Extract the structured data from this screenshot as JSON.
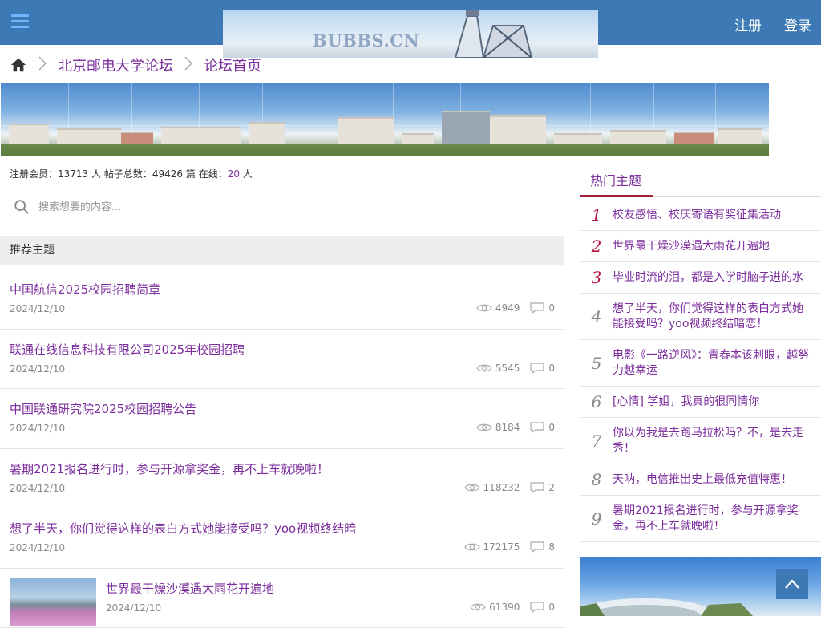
{
  "header": {
    "logo_text": "BUBBS.CN",
    "register_label": "注册",
    "login_label": "登录"
  },
  "breadcrumb": {
    "forum_name": "北京邮电大学论坛",
    "page_name": "论坛首页"
  },
  "stats": {
    "members_label": "注册会员：",
    "members_count": "13713",
    "members_unit": " 人 ",
    "posts_label": "帖子总数：",
    "posts_count": "49426",
    "posts_unit": " 篇 ",
    "online_label": "在线：",
    "online_count": "20",
    "online_unit": " 人"
  },
  "search": {
    "placeholder": "搜索想要的内容..."
  },
  "recommended": {
    "heading": "推荐主题",
    "topics": [
      {
        "title": "中国航信2025校园招聘简章",
        "date": "2024/12/10",
        "views": "4949",
        "replies": "0"
      },
      {
        "title": "联通在线信息科技有限公司2025年校园招聘",
        "date": "2024/12/10",
        "views": "5545",
        "replies": "0"
      },
      {
        "title": "中国联通研究院2025校园招聘公告",
        "date": "2024/12/10",
        "views": "8184",
        "replies": "0"
      },
      {
        "title": "暑期2021报名进行时，参与开源拿奖金，再不上车就晚啦！",
        "date": "2024/12/10",
        "views": "118232",
        "replies": "2"
      },
      {
        "title": "想了半天，你们觉得这样的表白方式她能接受吗？yoo视频终结暗",
        "date": "2024/12/10",
        "views": "172175",
        "replies": "8"
      },
      {
        "title": "世界最干燥沙漠遇大雨花开遍地",
        "date": "2024/12/10",
        "views": "61390",
        "replies": "0"
      }
    ]
  },
  "hot": {
    "heading": "热门主题",
    "items": [
      {
        "rank": "1",
        "title": "校友感悟、校庆寄语有奖征集活动"
      },
      {
        "rank": "2",
        "title": "世界最干燥沙漠遇大雨花开遍地"
      },
      {
        "rank": "3",
        "title": "毕业时流的泪，都是入学时脑子进的水"
      },
      {
        "rank": "4",
        "title": "想了半天，你们觉得这样的表白方式她能接受吗？yoo视频终结暗恋！"
      },
      {
        "rank": "5",
        "title": "电影《一路逆风》：青春本该刺眼，越努力越幸运"
      },
      {
        "rank": "6",
        "title": "[心情] 学姐，我真的很同情你"
      },
      {
        "rank": "7",
        "title": "你以为我是去跑马拉松吗？不，是去走秀！"
      },
      {
        "rank": "8",
        "title": "天呐，电信推出史上最低充值特惠！"
      },
      {
        "rank": "9",
        "title": "暑期2021报名进行时，参与开源拿奖金，再不上车就晚啦！"
      }
    ]
  },
  "colors": {
    "header_bg": "#3d79b4",
    "link_purple": "#7b2d9c",
    "rank_red": "#b0103c"
  }
}
